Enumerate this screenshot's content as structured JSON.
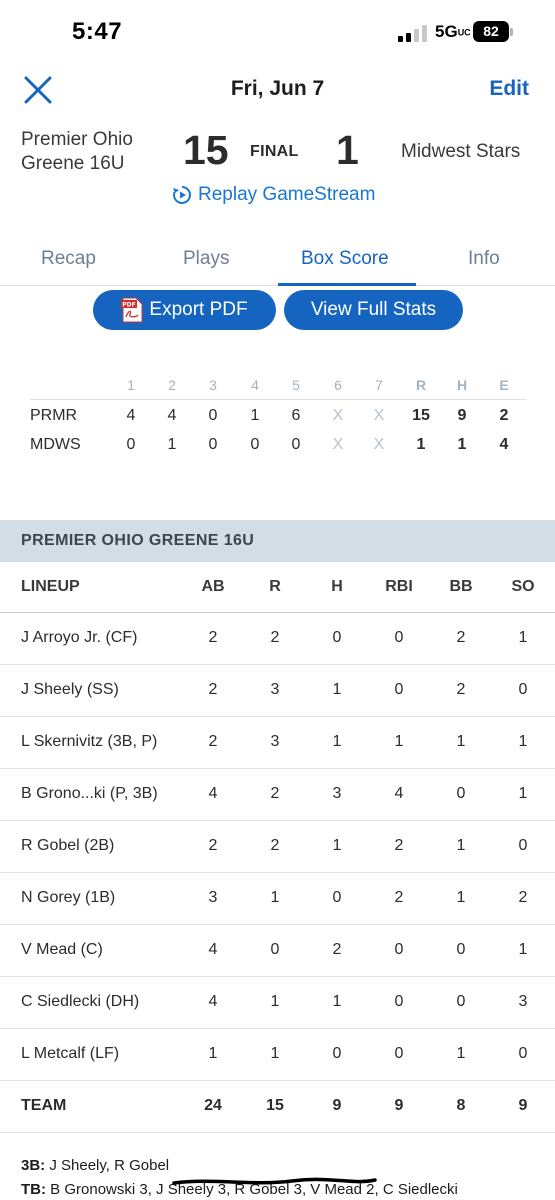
{
  "status_bar": {
    "time": "5:47",
    "network": "5G",
    "network_suffix": "UC",
    "battery": "82"
  },
  "header": {
    "close_icon": "close-x-icon",
    "date": "Fri, Jun 7",
    "edit_label": "Edit"
  },
  "score": {
    "home_team": "Premier Ohio Greene 16U",
    "home_score": "15",
    "status": "FINAL",
    "away_score": "1",
    "away_team": "Midwest Stars",
    "replay_label": "Replay GameStream",
    "replay_icon": "replay-play-icon"
  },
  "tabs": [
    {
      "label": "Recap"
    },
    {
      "label": "Plays"
    },
    {
      "label": "Box Score"
    },
    {
      "label": "Info"
    }
  ],
  "actions": {
    "export_label": "Export PDF",
    "pdf_icon_text": "PDF",
    "full_stats_label": "View Full Stats"
  },
  "linescore": {
    "headers": [
      "1",
      "2",
      "3",
      "4",
      "5",
      "6",
      "7",
      "R",
      "H",
      "E"
    ],
    "rows": [
      {
        "team": "PRMR",
        "cells": [
          "4",
          "4",
          "0",
          "1",
          "6",
          "X",
          "X",
          "15",
          "9",
          "2"
        ]
      },
      {
        "team": "MDWS",
        "cells": [
          "0",
          "1",
          "0",
          "0",
          "0",
          "X",
          "X",
          "1",
          "1",
          "4"
        ]
      }
    ]
  },
  "box": {
    "team_header": "PREMIER OHIO GREENE 16U",
    "columns": [
      "LINEUP",
      "AB",
      "R",
      "H",
      "RBI",
      "BB",
      "SO"
    ],
    "players": [
      {
        "name": "J Arroyo Jr. (CF)",
        "stats": [
          "2",
          "2",
          "0",
          "0",
          "2",
          "1"
        ]
      },
      {
        "name": "J Sheely (SS)",
        "stats": [
          "2",
          "3",
          "1",
          "0",
          "2",
          "0"
        ]
      },
      {
        "name": "L Skernivitz (3B, P)",
        "stats": [
          "2",
          "3",
          "1",
          "1",
          "1",
          "1"
        ]
      },
      {
        "name": "B Grono...ki (P, 3B)",
        "stats": [
          "4",
          "2",
          "3",
          "4",
          "0",
          "1"
        ]
      },
      {
        "name": "R Gobel (2B)",
        "stats": [
          "2",
          "2",
          "1",
          "2",
          "1",
          "0"
        ]
      },
      {
        "name": "N Gorey (1B)",
        "stats": [
          "3",
          "1",
          "0",
          "2",
          "1",
          "2"
        ]
      },
      {
        "name": "V Mead (C)",
        "stats": [
          "4",
          "0",
          "2",
          "0",
          "0",
          "1"
        ]
      },
      {
        "name": "C Siedlecki (DH)",
        "stats": [
          "4",
          "1",
          "1",
          "0",
          "0",
          "3"
        ]
      },
      {
        "name": "L Metcalf (LF)",
        "stats": [
          "1",
          "1",
          "0",
          "0",
          "1",
          "0"
        ]
      }
    ],
    "team_total": {
      "name": "TEAM",
      "stats": [
        "24",
        "15",
        "9",
        "9",
        "8",
        "9"
      ]
    }
  },
  "notes": {
    "line1_label": "3B:",
    "line1_text": "J Sheely, R Gobel",
    "line2_label": "TB:",
    "line2_text": "B Gronowski 3, J Sheely 3, R Gobel 3, V Mead 2, C Siedlecki"
  },
  "colors": {
    "accent": "#1565c0",
    "section_header_bg": "#d3dde5",
    "muted": "#6e7f92"
  }
}
